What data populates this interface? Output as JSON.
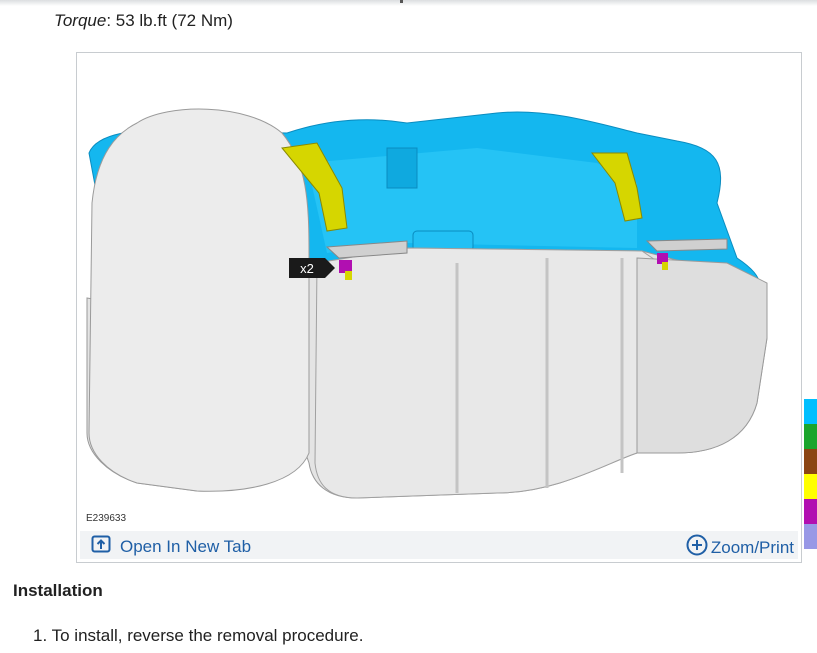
{
  "spec": {
    "torque_label": "Torque",
    "torque_separator": ":",
    "torque_value": " 53 lb.ft (72 Nm)"
  },
  "figure": {
    "id": "E239633",
    "callout": "x2",
    "open_tab_label": "Open In New Tab",
    "zoom_print_label": "Zoom/Print",
    "open_tab_icon": "open-in-new-tab-icon",
    "zoom_icon": "plus-circle-icon"
  },
  "legend": {
    "colors": [
      "#00bfff",
      "#1aa52c",
      "#8b4513",
      "#ffff00",
      "#b10fb1",
      "#9898e6"
    ]
  },
  "section": {
    "heading": "Installation",
    "steps": [
      {
        "number": "1.",
        "text": "To install, reverse the removal procedure."
      }
    ]
  }
}
